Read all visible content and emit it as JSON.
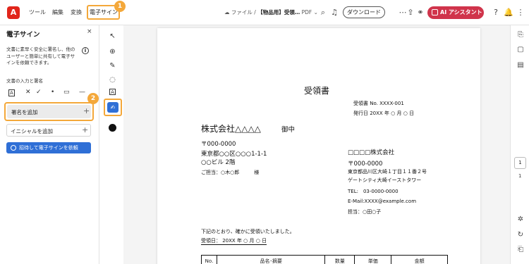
{
  "topbar": {
    "menu": [
      "ツール",
      "編集",
      "変換",
      "電子サイン"
    ],
    "badge1": "1",
    "file_prefix": "ファイル",
    "file_name": "【物品用】受領…",
    "file_type": "PDF",
    "download_label": "ダウンロード",
    "ai_label": "AI アシスタント"
  },
  "panel": {
    "title": "電子サイン",
    "close": "×",
    "description": "文書に素早く安全に署名し、他のユーザーと簡単に共有して電子サインを依頼できます。",
    "section_label": "文書の入力と署名",
    "badge2": "2",
    "add_signature": "署名を追加",
    "add_initials": "イニシャルを追加",
    "request_button": "招待して電子サインを依頼",
    "plus": "+"
  },
  "document": {
    "title": "受領書",
    "receipt_no": "受領書 No. XXXX-001",
    "issue_date": "発行日 20XX 年 ○ 月 ○ 日",
    "company": "株式会社△△△△",
    "honorific": "御中",
    "to_zip": "〒000-0000",
    "to_address1": "東京都○○区○○○1-1-1",
    "to_address2": "○○ビル 2階",
    "to_person": "ご担当：○木○郎　　　様",
    "from_company": "□□□□株式会社",
    "from_zip": "〒000-0000",
    "from_address1": "東京都品川区大崎１丁目１１番２号",
    "from_address2": "ゲートシティ大崎イーストタワー",
    "from_tel": "TEL:　03-0000-0000",
    "from_email": "E-Mail:XXXX@example.com",
    "from_person": "担当：○田○子",
    "received_text": "下記のとおり、確かに受領いたしました。",
    "received_date": "受領日：  20XX 年 ○ 月 ○ 日",
    "table_headers": [
      "No.",
      "品名･摘要",
      "数量",
      "単価",
      "金額"
    ]
  },
  "rail": {
    "page_number": "1",
    "page_total": "1"
  },
  "colors": {
    "accent": "#f4a83a",
    "brand": "#e1251b",
    "ai": "#d0344b",
    "primary": "#2f6fd6"
  }
}
